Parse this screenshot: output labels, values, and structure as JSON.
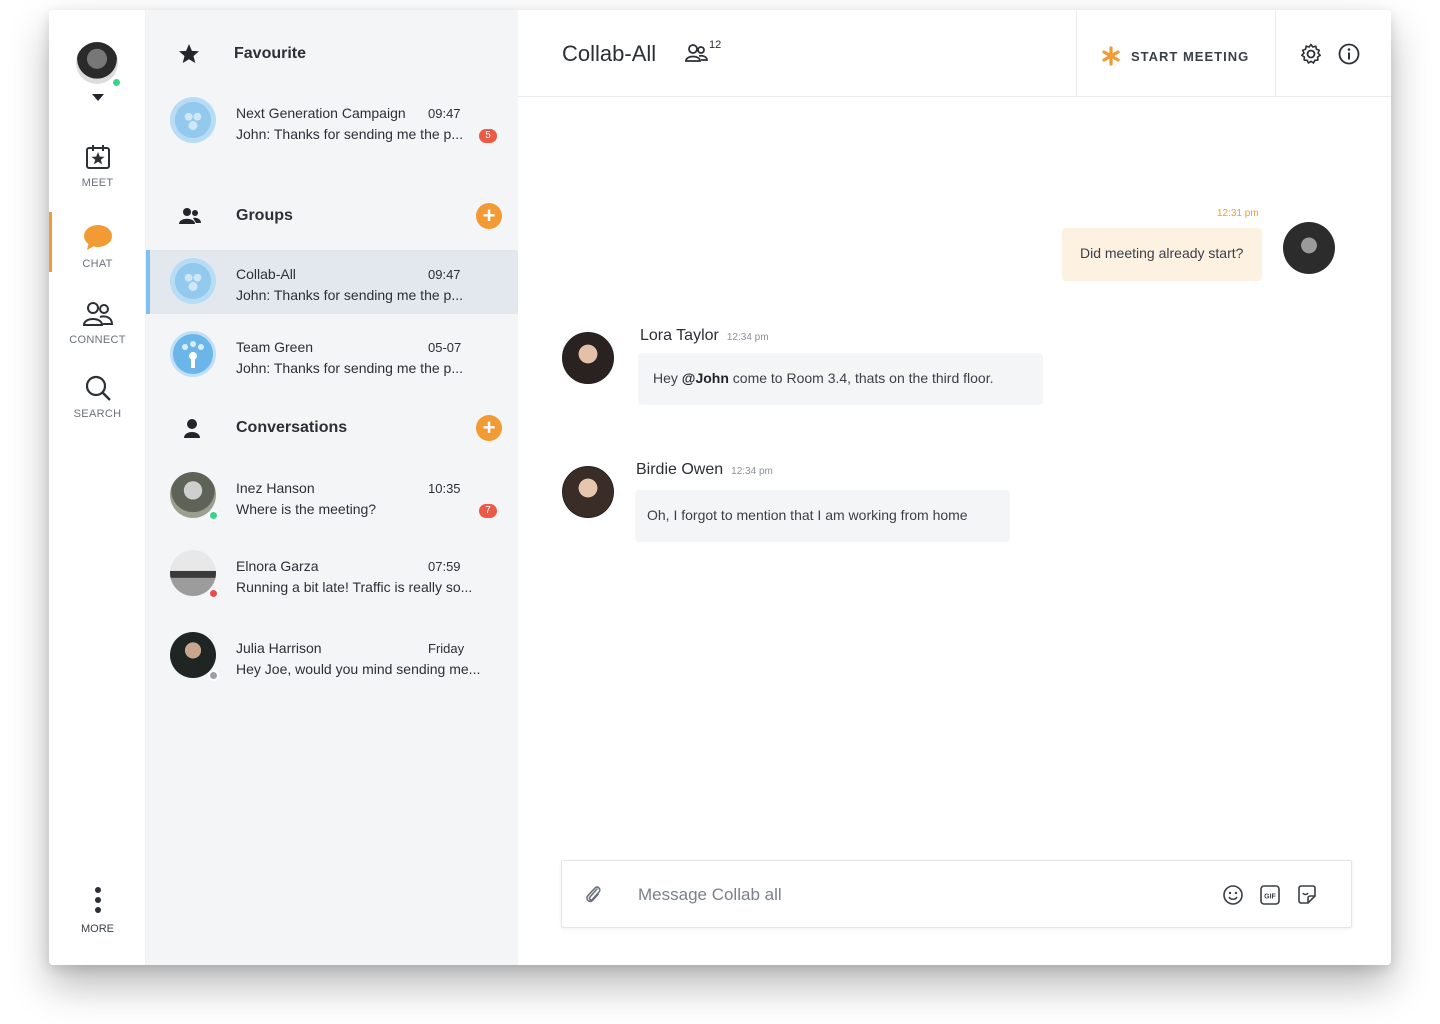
{
  "nav": {
    "items": [
      {
        "label": "MEET",
        "icon": "calendar-star-icon"
      },
      {
        "label": "CHAT",
        "icon": "chat-bubble-icon"
      },
      {
        "label": "CONNECT",
        "icon": "people-icon"
      },
      {
        "label": "SEARCH",
        "icon": "search-icon"
      }
    ],
    "more_label": "MORE",
    "accent": "#f29a34"
  },
  "favourite": {
    "title": "Favourite",
    "items": [
      {
        "name": "Next Generation Campaign",
        "time": "09:47",
        "preview": "John: Thanks for sending me the p...",
        "badge": "5"
      }
    ]
  },
  "groups": {
    "title": "Groups",
    "items": [
      {
        "name": "Collab-All",
        "time": "09:47",
        "preview": "John: Thanks for sending me the p..."
      },
      {
        "name": "Team Green",
        "time": "05-07",
        "preview": "John: Thanks for sending me the p..."
      }
    ]
  },
  "conversations": {
    "title": "Conversations",
    "items": [
      {
        "name": "Inez Hanson",
        "time": "10:35",
        "preview": "Where is the meeting?",
        "badge": "7",
        "status": "online"
      },
      {
        "name": "Elnora Garza",
        "time": "07:59",
        "preview": "Running a bit late! Traffic is really so...",
        "status": "busy"
      },
      {
        "name": "Julia Harrison",
        "time": "Friday",
        "preview": "Hey Joe, would you mind sending me...",
        "status": "offline"
      }
    ]
  },
  "header": {
    "title": "Collab-All",
    "member_count": "12",
    "start_meeting_label": "START MEETING"
  },
  "messages": {
    "outgoing": {
      "time": "12:31 pm",
      "text": "Did meeting already start?"
    },
    "incoming": [
      {
        "sender": "Lora Taylor",
        "time": "12:34 pm",
        "prefix": "Hey ",
        "mention": "@John",
        "text": " come to Room 3.4, thats on the third floor."
      },
      {
        "sender": "Birdie Owen",
        "time": "12:34 pm",
        "text": "Oh, I forgot to mention that I am working from home"
      }
    ]
  },
  "composer": {
    "placeholder": "Message Collab all"
  }
}
